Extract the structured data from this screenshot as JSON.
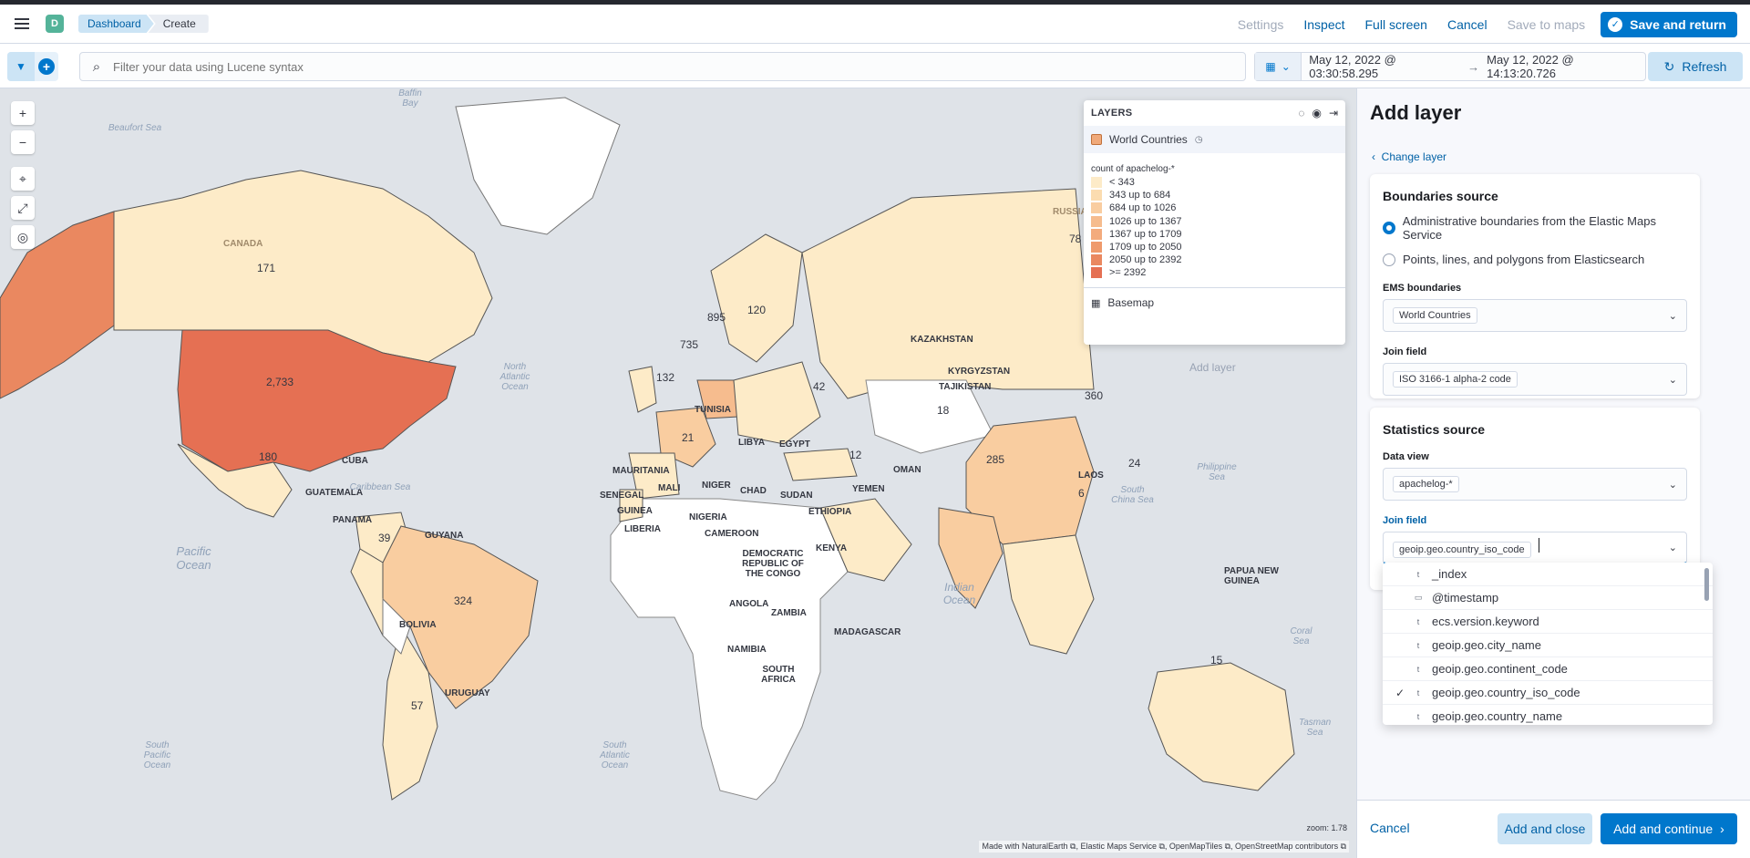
{
  "header": {
    "space_initial": "D",
    "breadcrumbs": [
      "Dashboard",
      "Create"
    ],
    "links": {
      "settings": "Settings",
      "inspect": "Inspect",
      "full_screen": "Full screen",
      "cancel": "Cancel",
      "save_to_maps": "Save to maps",
      "save_and_return": "Save and return"
    }
  },
  "querybar": {
    "search_placeholder": "Filter your data using Lucene syntax",
    "date_start": "May 12, 2022 @ 03:30:58.295",
    "date_end": "May 12, 2022 @ 14:13:20.726",
    "refresh": "Refresh"
  },
  "map": {
    "zoom_label": "zoom: 1.78",
    "attribution": "Made with NaturalEarth ⧉, Elastic Maps Service ⧉, OpenMapTiles ⧉, OpenStreetMap contributors ⧉",
    "country_values": [
      {
        "label": "171"
      },
      {
        "label": "2,733"
      },
      {
        "label": "180"
      },
      {
        "label": "324"
      },
      {
        "label": "895"
      },
      {
        "label": "735"
      },
      {
        "label": "120"
      },
      {
        "label": "360"
      },
      {
        "label": "285"
      },
      {
        "label": "15"
      },
      {
        "label": "132"
      },
      {
        "label": "42"
      },
      {
        "label": "12"
      },
      {
        "label": "21"
      },
      {
        "label": "39"
      },
      {
        "label": "57"
      },
      {
        "label": "78"
      },
      {
        "label": "18"
      },
      {
        "label": "24"
      },
      {
        "label": "6"
      }
    ],
    "country_names": [
      "CANADA",
      "CUBA",
      "GUATEMALA",
      "PANAMA",
      "GUYANA",
      "BOLIVIA",
      "URUGUAY",
      "LIBYA",
      "EGYPT",
      "MAURITANIA",
      "MALI",
      "NIGER",
      "CHAD",
      "SUDAN",
      "SENEGAL",
      "GUINEA",
      "LIBERIA",
      "NIGERIA",
      "ETHIOPIA",
      "CAMEROON",
      "KENYA",
      "DEMOCRATIC REPUBLIC OF THE CONGO",
      "ANGOLA",
      "ZAMBIA",
      "NAMIBIA",
      "SOUTH AFRICA",
      "MADAGASCAR",
      "YEMEN",
      "OMAN",
      "KAZAKHSTAN",
      "KYRGYZSTAN",
      "TAJIKISTAN",
      "LAOS",
      "PAPUA NEW GUINEA",
      "TUNISIA",
      "RUSSIA"
    ],
    "sea_names": [
      "Baffin Bay",
      "Beaufort Sea",
      "North Atlantic Ocean",
      "Pacific Ocean",
      "Indian Ocean",
      "South Pacific Ocean",
      "South Atlantic Ocean",
      "Caribbean Sea",
      "Philippine Sea",
      "South China Sea",
      "Coral Sea",
      "Tasman Sea"
    ]
  },
  "layers_panel": {
    "title": "LAYERS",
    "layer_name": "World Countries",
    "legend_title": "count of apachelog-*",
    "legend": [
      {
        "label": "< 343",
        "color": "#fdebc8"
      },
      {
        "label": "343 up to 684",
        "color": "#fbdcb0"
      },
      {
        "label": "684 up to 1026",
        "color": "#f9cda0"
      },
      {
        "label": "1026 up to 1367",
        "color": "#f6bc8e"
      },
      {
        "label": "1367 up to 1709",
        "color": "#f3ab7d"
      },
      {
        "label": "1709 up to 2050",
        "color": "#ef9a6c"
      },
      {
        "label": "2050 up to 2392",
        "color": "#ea8860"
      },
      {
        "label": ">= 2392",
        "color": "#e57053"
      }
    ],
    "basemap": "Basemap",
    "add_layer_ghost": "Add layer"
  },
  "add_layer": {
    "title": "Add layer",
    "change_layer": "Change layer",
    "boundaries": {
      "title": "Boundaries source",
      "option_ems": "Administrative boundaries from the Elastic Maps Service",
      "option_es": "Points, lines, and polygons from Elasticsearch",
      "ems_label": "EMS boundaries",
      "ems_value": "World Countries",
      "join_label": "Join field",
      "join_value": "ISO 3166-1 alpha-2 code"
    },
    "statistics": {
      "title": "Statistics source",
      "data_view_label": "Data view",
      "data_view_value": "apachelog-*",
      "join_label": "Join field",
      "join_value": "geoip.geo.country_iso_code"
    },
    "dropdown_options": [
      {
        "label": "_index",
        "type": "t",
        "checked": false
      },
      {
        "label": "@timestamp",
        "type": "date",
        "checked": false
      },
      {
        "label": "ecs.version.keyword",
        "type": "t",
        "checked": false
      },
      {
        "label": "geoip.geo.city_name",
        "type": "t",
        "checked": false
      },
      {
        "label": "geoip.geo.continent_code",
        "type": "t",
        "checked": false
      },
      {
        "label": "geoip.geo.country_iso_code",
        "type": "t",
        "checked": true
      },
      {
        "label": "geoip.geo.country_name",
        "type": "t",
        "checked": false
      }
    ],
    "footer": {
      "cancel": "Cancel",
      "add_and_close": "Add and close",
      "add_and_continue": "Add and continue"
    }
  }
}
